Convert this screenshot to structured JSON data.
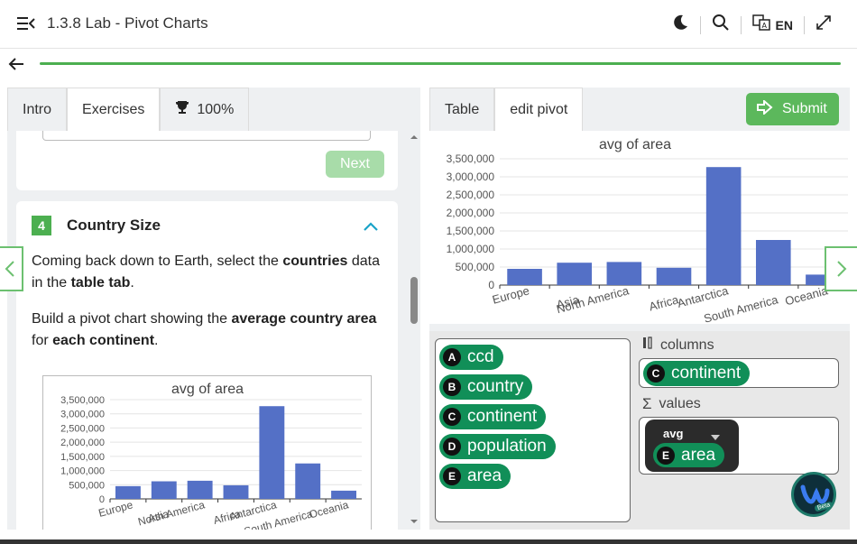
{
  "header": {
    "title": "1.3.8 Lab - Pivot Charts",
    "lang": "EN"
  },
  "left": {
    "tabs": [
      "Intro",
      "Exercises",
      "100%"
    ],
    "next_label": "Next",
    "step_number": "4",
    "step_title": "Country Size",
    "para1": [
      "Coming back down to Earth, select the ",
      "countries",
      " data in the ",
      "table tab",
      "."
    ],
    "para2": [
      "Build a pivot chart showing the ",
      "average country area",
      " for ",
      "each continent",
      "."
    ]
  },
  "right": {
    "tabs": [
      "Table",
      "edit pivot"
    ],
    "submit_label": "Submit",
    "fields": [
      {
        "letter": "A",
        "name": "ccd"
      },
      {
        "letter": "B",
        "name": "country"
      },
      {
        "letter": "C",
        "name": "continent"
      },
      {
        "letter": "D",
        "name": "population"
      },
      {
        "letter": "E",
        "name": "area"
      }
    ],
    "columns_label": "columns",
    "columns_field": {
      "letter": "C",
      "name": "continent"
    },
    "values_label": "values",
    "values_agg": "avg",
    "values_field": {
      "letter": "E",
      "name": "area"
    }
  },
  "colors": {
    "bar": "#5470c6",
    "green": "#4caf50",
    "pill": "#118f58"
  },
  "chart_data": {
    "type": "bar",
    "title": "avg of area",
    "categories": [
      "Europe",
      "Asia",
      "North America",
      "Africa",
      "Antarctica",
      "South America",
      "Oceania"
    ],
    "values": [
      450000,
      620000,
      640000,
      480000,
      3270000,
      1250000,
      290000
    ],
    "ylim": [
      0,
      3500000
    ],
    "yticks": [
      "0",
      "500,000",
      "1,000,000",
      "1,500,000",
      "2,000,000",
      "2,500,000",
      "3,000,000",
      "3,500,000"
    ]
  }
}
